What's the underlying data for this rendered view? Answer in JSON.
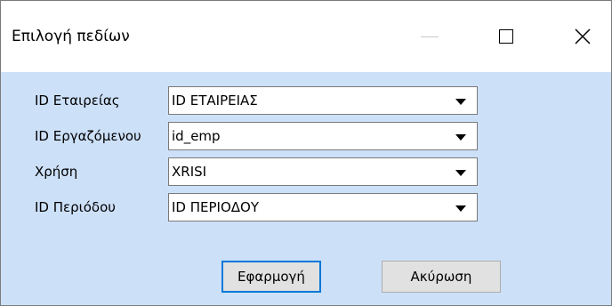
{
  "window": {
    "title": "Επιλογή πεδίων"
  },
  "fields": [
    {
      "label": "ID Εταιρείας",
      "value": "ID ΕΤΑΙΡΕΙΑΣ"
    },
    {
      "label": "ID Εργαζόμενου",
      "value": "id_emp"
    },
    {
      "label": "Χρήση",
      "value": "XRISI"
    },
    {
      "label": "ID Περιόδου",
      "value": "ID ΠΕΡΙΟΔΟΥ"
    }
  ],
  "buttons": {
    "apply_label": "Εφαρμογή",
    "cancel_label": "Ακύρωση"
  },
  "icons": {
    "minimize": "minimize-icon",
    "maximize": "maximize-icon",
    "close": "close-icon",
    "dropdown": "chevron-down-icon"
  },
  "colors": {
    "client_background": "#cce0f8",
    "default_button_border": "#0078d7"
  }
}
